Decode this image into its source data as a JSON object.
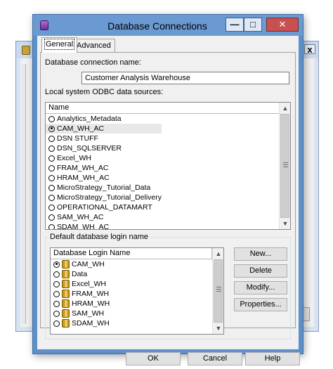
{
  "window": {
    "title": "Database Connections",
    "minimize_glyph": "—",
    "maximize_glyph": "□",
    "close_glyph": "✕"
  },
  "tabs": [
    {
      "label": "General",
      "selected": true
    },
    {
      "label": "Advanced",
      "selected": false
    }
  ],
  "general": {
    "connection_name_label": "Database connection name:",
    "connection_name_value": "Customer Analysis Warehouse",
    "odbc_label": "Local system ODBC data sources:",
    "odbc_header": "Name",
    "odbc_sources": [
      "Analytics_Metadata",
      "CAM_WH_AC",
      "DSN STUFF",
      "DSN_SQLSERVER",
      "Excel_WH",
      "FRAM_WH_AC",
      "HRAM_WH_AC",
      "MicroStrategy_Tutorial_Data",
      "MicroStrategy_Tutorial_Delivery",
      "OPERATIONAL_DATAMART",
      "SAM_WH_AC",
      "SDAM_WH_AC"
    ],
    "odbc_selected": "CAM_WH_AC",
    "login_group_label": "Default database login name",
    "login_header": "Database Login Name",
    "logins": [
      "CAM_WH",
      "Data",
      "Excel_WH",
      "FRAM_WH",
      "HRAM_WH",
      "SAM_WH",
      "SDAM_WH"
    ],
    "login_selected": "CAM_WH",
    "buttons": {
      "new": "New...",
      "delete": "Delete",
      "modify": "Modify...",
      "properties": "Properties..."
    }
  },
  "footer": {
    "ok": "OK",
    "cancel": "Cancel",
    "help": "Help"
  }
}
